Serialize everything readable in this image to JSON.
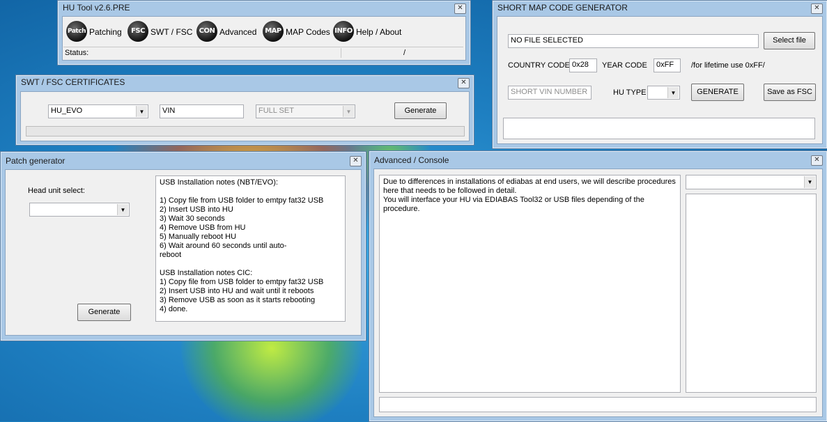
{
  "hu_tool": {
    "title": "HU Tool v2.6.PRE",
    "toolbar": [
      {
        "icon": "Patch",
        "label": "Patching"
      },
      {
        "icon": "FSC",
        "label": "SWT / FSC"
      },
      {
        "icon": "CON",
        "label": "Advanced"
      },
      {
        "icon": "MAP",
        "label": "MAP Codes"
      },
      {
        "icon": "INFO",
        "label": "Help / About"
      }
    ],
    "status_label": "Status:",
    "status_separator": "/"
  },
  "swt": {
    "title": "SWT / FSC CERTIFICATES",
    "unit_value": "HU_EVO",
    "vin_value": "VIN",
    "set_value": "FULL SET",
    "generate_label": "Generate"
  },
  "patch": {
    "title": "Patch generator",
    "head_unit_label": "Head unit select:",
    "head_unit_value": "",
    "generate_label": "Generate",
    "notes": "USB Installation notes (NBT/EVO):\n\n1) Copy file from USB folder to emtpy fat32 USB\n2) Insert USB into HU\n3) Wait 30 seconds\n4) Remove USB from HU\n5) Manually reboot HU\n6) Wait around 60 seconds until auto-\nreboot\n\nUSB Installation notes CIC:\n1) Copy file from USB folder to emtpy fat32 USB\n2) Insert USB into HU and wait until it reboots\n3) Remove USB as soon as it starts rebooting\n4) done."
  },
  "map": {
    "title": "SHORT MAP CODE GENERATOR",
    "file_value": "NO FILE SELECTED",
    "select_file_label": "Select file",
    "country_code_label": "COUNTRY CODE",
    "country_code_value": "0x28",
    "year_code_label": "YEAR CODE",
    "year_code_value": "0xFF",
    "lifetime_hint": "/for lifetime use 0xFF/",
    "vin_placeholder": "SHORT VIN NUMBER",
    "hu_type_label": "HU TYPE",
    "hu_type_value": "",
    "generate_label": "GENERATE",
    "save_label": "Save as FSC",
    "output_value": ""
  },
  "advanced": {
    "title": "Advanced / Console",
    "console_text": "Due to differences in installations of ediabas at end users, we will describe procedures here that needs to be followed in detail.\nYou will interface your HU via EDIABAS Tool32 or USB files depending of the procedure.",
    "dropdown_value": "",
    "command_value": ""
  }
}
